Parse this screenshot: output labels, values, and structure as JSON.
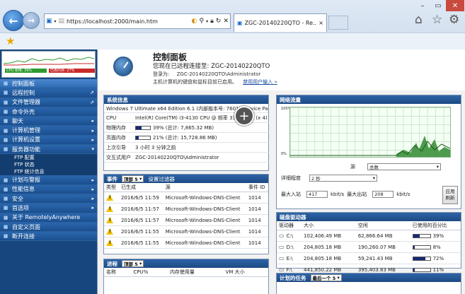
{
  "browser": {
    "address": "https://localhost:2000/main.htm",
    "tab_title": "ZGC-20140220QTO - Re...",
    "close_glyph": "×"
  },
  "sidebar": {
    "cpu_label": "CPU 使用: 39%",
    "cpu_fraction": 0.39,
    "mem_label": "已用内存: 27%",
    "mem_fraction": 0.27,
    "items": [
      {
        "label": "控制面板",
        "icon": "dashboard-icon",
        "active": true
      },
      {
        "label": "远程控制",
        "icon": "remote-icon",
        "arrow": "⇗"
      },
      {
        "label": "文件管理器",
        "icon": "folder-icon",
        "arrow": "⇗"
      },
      {
        "label": "命令外壳",
        "icon": "terminal-icon"
      },
      {
        "label": "聊天",
        "icon": "chat-icon",
        "arrow": "▸"
      },
      {
        "label": "计算机管理",
        "icon": "computer-icon",
        "arrow": "▸"
      },
      {
        "label": "计算机设置",
        "icon": "settings-icon",
        "arrow": "▸"
      },
      {
        "label": "服务器功能",
        "icon": "server-icon",
        "arrow": "▾"
      }
    ],
    "sub_items": [
      "FTP 配置",
      "FTP 状态",
      "FTP 统计信息"
    ],
    "items2": [
      {
        "label": "计划与警报",
        "icon": "alarm-icon",
        "arrow": "▸"
      },
      {
        "label": "性能信息",
        "icon": "performance-icon",
        "arrow": "▸"
      },
      {
        "label": "安全",
        "icon": "security-icon",
        "arrow": "▸"
      },
      {
        "label": "首选项",
        "icon": "preferences-icon",
        "arrow": "▸"
      },
      {
        "label": "关于 RemotelyAnywhere",
        "icon": "about-icon"
      },
      {
        "label": "自定义页面",
        "icon": "page-icon"
      },
      {
        "label": "断开连接",
        "icon": "disconnect-icon"
      }
    ]
  },
  "header": {
    "title": "控制面板",
    "connected": "您现在已远程连接至:  ZGC-20140220QTO",
    "login_label": "登录为:",
    "login_value": "ZGC-20140220QTO\\Administrator",
    "note": "主机计算机的键盘和鼠标目前已启用。",
    "note_link": "禁用用户输入 »"
  },
  "sysinfo": {
    "title": "系统信息",
    "os": "Windows 7 Ultimate x64 Edition 6.1 (内部版本号: 7601) Service Pack 1",
    "rows": [
      {
        "k": "CPU",
        "v": "Intel(R) Core(TM) i3-4130 CPU @ 频率 3399 MHz (x 4)"
      },
      {
        "k": "物理内存",
        "v": "39% (总计: 7,865.32 MB)",
        "bar": 0.39
      },
      {
        "k": "页面内存",
        "v": "21% (总计: 15,728.86 MB)",
        "bar": 0.21
      },
      {
        "k": "上次引导",
        "v": "3 小时  3 分钟之前"
      },
      {
        "k": "交互式用户",
        "v": "ZGC-20140220QTO\\Administrator"
      }
    ]
  },
  "events": {
    "title": "事件",
    "top_select": "顶部 5",
    "filter_link": "设置过滤器",
    "columns": [
      "类型",
      "已生成",
      "源",
      "事件 ID"
    ],
    "rows": [
      {
        "date": "2016/6/5 11:59",
        "source": "Microsoft-Windows-DNS-Client",
        "id": "1014"
      },
      {
        "date": "2016/6/5 11:57",
        "source": "Microsoft-Windows-DNS-Client",
        "id": "1014"
      },
      {
        "date": "2016/6/5 11:57",
        "source": "Microsoft-Windows-DNS-Client",
        "id": "1014"
      },
      {
        "date": "2016/6/5 11:55",
        "source": "Microsoft-Windows-DNS-Client",
        "id": "1014"
      },
      {
        "date": "2016/6/5 11:55",
        "source": "Microsoft-Windows-DNS-Client",
        "id": "1014"
      }
    ]
  },
  "processes": {
    "title": "进程",
    "top_select": "顶部 5",
    "columns": [
      "名称",
      "CPU%",
      "内存使用量",
      "VM 大小"
    ]
  },
  "network": {
    "title": "网络流量",
    "y_top": "100%",
    "y_bottom": "0%",
    "source_label": "源",
    "source_value": "总数",
    "detail_label": "详细程度",
    "detail_value": "2 秒",
    "max_in_label": "最大入站",
    "max_in_value": "417",
    "max_out_label": "最大出站",
    "max_out_value": "208",
    "unit": "kbit/s",
    "apply": "应用",
    "refresh": "刷新"
  },
  "disks": {
    "title": "磁盘驱动器",
    "columns": [
      "驱动器",
      "大小",
      "空闲",
      "已使用的百分比"
    ],
    "rows": [
      {
        "drive": "C:\\",
        "size": "102,406.49 MB",
        "free": "62,866.64 MB",
        "pct": "39%",
        "frac": 0.39
      },
      {
        "drive": "D:\\",
        "size": "204,805.18 MB",
        "free": "190,260.07 MB",
        "pct": "8%",
        "frac": 0.08
      },
      {
        "drive": "E:\\",
        "size": "204,805.18 MB",
        "free": "59,241.43 MB",
        "pct": "72%",
        "frac": 0.72
      },
      {
        "drive": "F:\\",
        "size": "441,850.22 MB",
        "free": "395,403.83 MB",
        "pct": "11%",
        "frac": 0.11
      }
    ]
  },
  "tasks": {
    "title": "计划的任务",
    "select": "最后一个 5"
  }
}
